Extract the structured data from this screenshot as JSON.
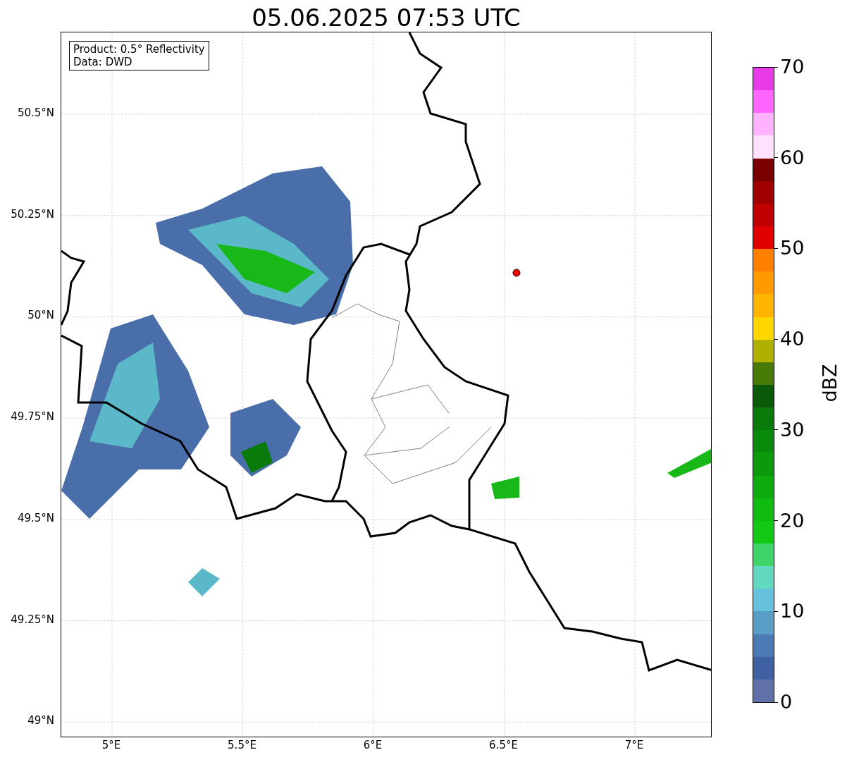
{
  "title": "05.06.2025 07:53 UTC",
  "info_box": [
    "Product: 0.5° Reflectivity",
    "Data: DWD"
  ],
  "lat_ticks": [
    "50.5°N",
    "50.25°N",
    "50°N",
    "49.75°N",
    "49.5°N",
    "49.25°N",
    "49°N"
  ],
  "lon_ticks": [
    "5°E",
    "5.5°E",
    "6°E",
    "6.5°E",
    "7°E"
  ],
  "colorbar": {
    "label": "dBZ",
    "ticks": [
      "70",
      "60",
      "50",
      "40",
      "30",
      "20",
      "10",
      "0"
    ],
    "segments": [
      {
        "color": "#e93ae9"
      },
      {
        "color": "#ff66ff"
      },
      {
        "color": "#ffb3ff"
      },
      {
        "color": "#ffe0ff"
      },
      {
        "color": "#7a0000"
      },
      {
        "color": "#a00000"
      },
      {
        "color": "#c00000"
      },
      {
        "color": "#e00000"
      },
      {
        "color": "#ff7f00"
      },
      {
        "color": "#ff9a00"
      },
      {
        "color": "#ffb400"
      },
      {
        "color": "#ffd700"
      },
      {
        "color": "#b0b000"
      },
      {
        "color": "#487a08"
      },
      {
        "color": "#0a5a0a"
      },
      {
        "color": "#0a7a0a"
      },
      {
        "color": "#0a8a0a"
      },
      {
        "color": "#0c9a0c"
      },
      {
        "color": "#0eab0e"
      },
      {
        "color": "#10bb10"
      },
      {
        "color": "#12c812"
      },
      {
        "color": "#3ed46a"
      },
      {
        "color": "#62d8c0"
      },
      {
        "color": "#66c2dc"
      },
      {
        "color": "#5a9ec8"
      },
      {
        "color": "#4a7ab4"
      },
      {
        "color": "#4060a4"
      },
      {
        "color": "#6070a8"
      }
    ]
  }
}
